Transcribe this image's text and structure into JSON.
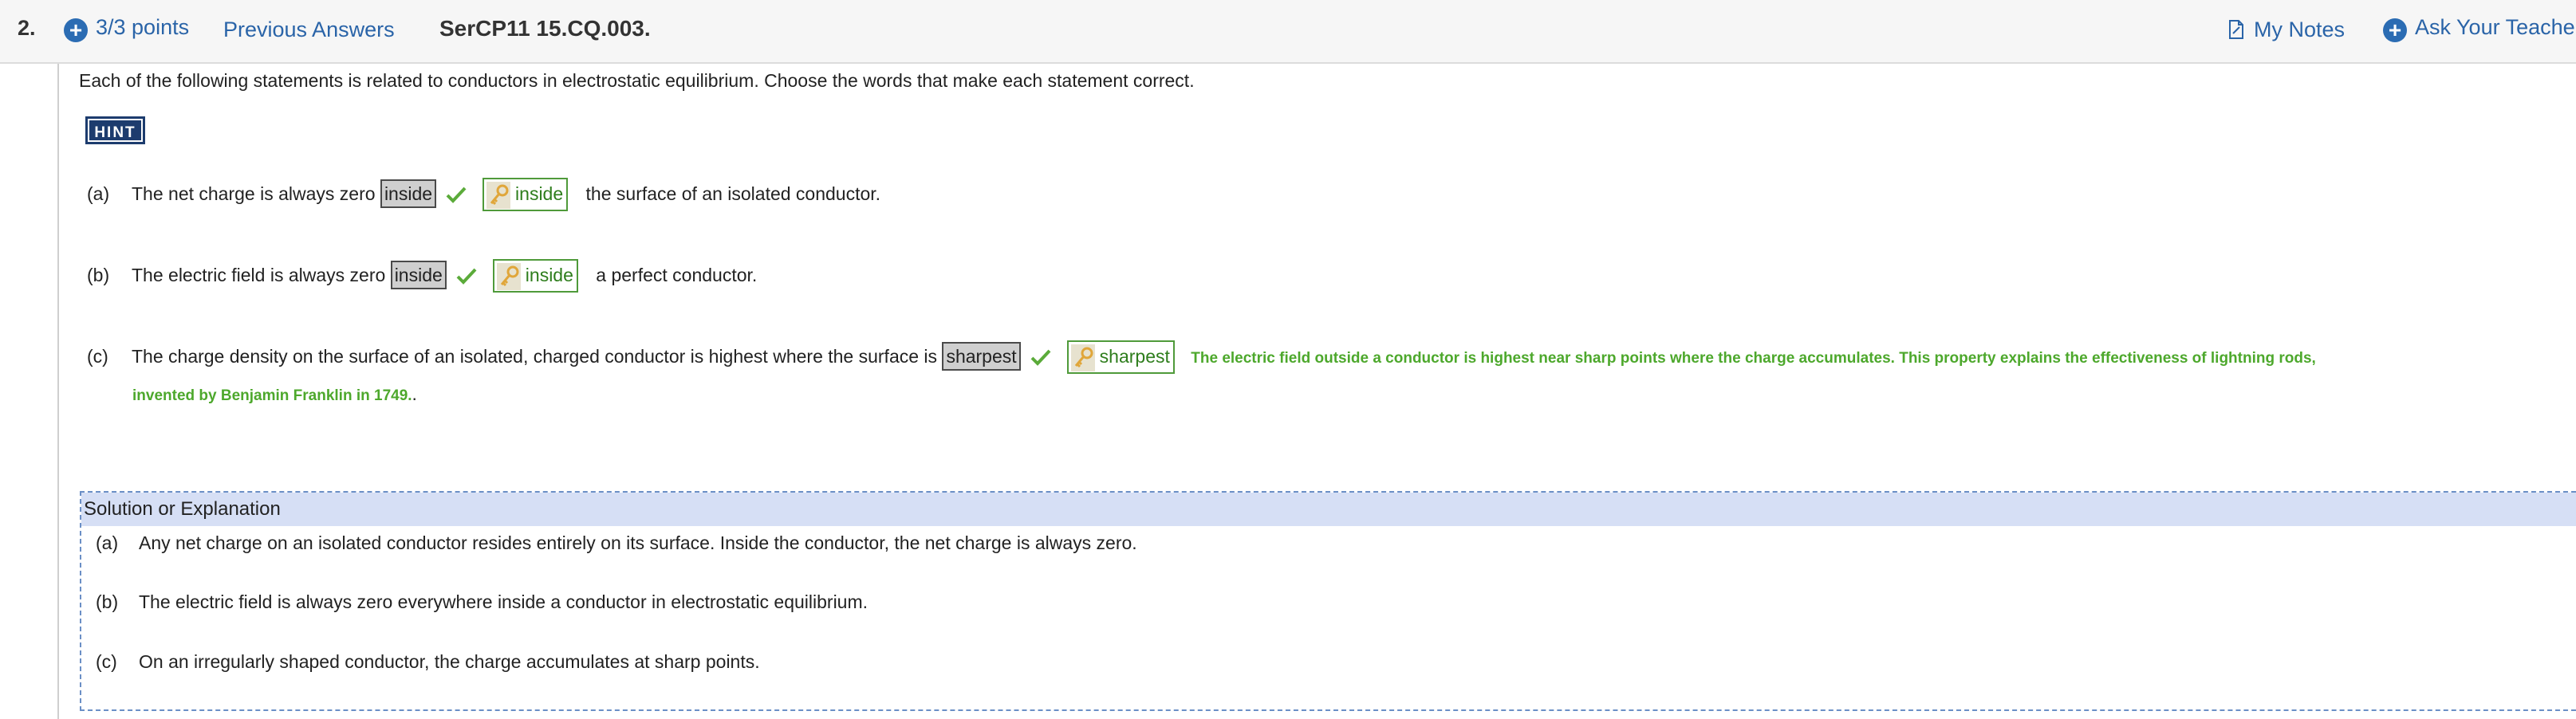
{
  "header": {
    "question_number": "2.",
    "points": "3/3 points",
    "previous_answers": "Previous Answers",
    "question_code": "SerCP11 15.CQ.003.",
    "my_notes": "My Notes",
    "ask_teacher": "Ask Your Teache"
  },
  "question": {
    "prompt": "Each of the following statements is related to conductors in electrostatic equilibrium. Choose the words that make each statement correct.",
    "hint_label": "HINT",
    "parts": [
      {
        "label": "(a)",
        "before": "The net charge is always zero",
        "selected": "inside",
        "key": "inside",
        "after": "the surface of an isolated conductor."
      },
      {
        "label": "(b)",
        "before": "The electric field is always zero",
        "selected": "inside",
        "key": "inside",
        "after": "a perfect conductor."
      },
      {
        "label": "(c)",
        "before": "The charge density on the surface of an isolated, charged conductor is highest where the surface is",
        "selected": "sharpest",
        "key": "sharpest",
        "feedback_line1": "The electric field outside a conductor is highest near sharp points where the charge accumulates. This property explains the effectiveness of lightning rods,",
        "feedback_line2": "invented by Benjamin Franklin in 1749.",
        "after": "."
      }
    ]
  },
  "solution": {
    "title": "Solution or Explanation",
    "items": [
      {
        "label": "(a)",
        "text": "Any net charge on an isolated conductor resides entirely on its surface. Inside the conductor, the net charge is always zero."
      },
      {
        "label": "(b)",
        "text": "The electric field is always zero everywhere inside a conductor in electrostatic equilibrium."
      },
      {
        "label": "(c)",
        "text": "On an irregularly shaped conductor, the charge accumulates at sharp points."
      }
    ]
  },
  "colors": {
    "link": "#2a64a8",
    "correct": "#4da82c",
    "hint_bg": "#1d3c6e",
    "solution_header_bg": "#d6dff5"
  },
  "icons": [
    "add-circle-icon",
    "notes-icon",
    "checkmark-icon",
    "key-icon"
  ]
}
